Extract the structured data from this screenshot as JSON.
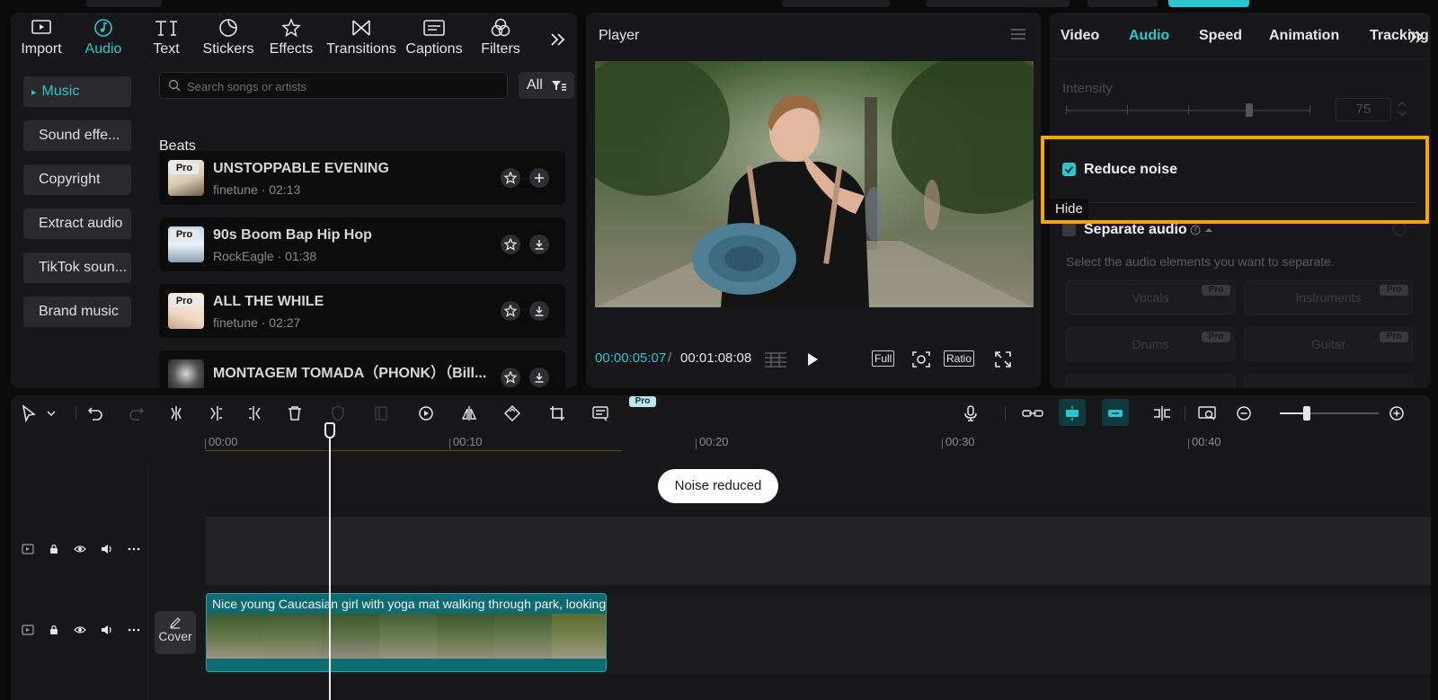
{
  "media_panel": {
    "tabs": [
      {
        "label": "Import",
        "icon": "import-icon"
      },
      {
        "label": "Audio",
        "icon": "audio-icon"
      },
      {
        "label": "Text",
        "icon": "text-icon"
      },
      {
        "label": "Stickers",
        "icon": "stickers-icon"
      },
      {
        "label": "Effects",
        "icon": "effects-icon"
      },
      {
        "label": "Transitions",
        "icon": "transitions-icon"
      },
      {
        "label": "Captions",
        "icon": "captions-icon"
      },
      {
        "label": "Filters",
        "icon": "filters-icon"
      }
    ],
    "active_tab": "Audio",
    "categories": [
      "Music",
      "Sound effe...",
      "Copyright",
      "Extract audio",
      "TikTok soun...",
      "Brand music"
    ],
    "active_category": "Music",
    "search_placeholder": "Search songs or artists",
    "filter_label": "All",
    "section_title": "Beats",
    "pro_badge": "Pro",
    "tracks": [
      {
        "name": "UNSTOPPABLE EVENING",
        "meta": "finetune · 02:13",
        "action": "add-icon"
      },
      {
        "name": "90s Boom Bap Hip Hop",
        "meta": "RockEagle · 01:38",
        "action": "download-icon"
      },
      {
        "name": "ALL THE WHILE",
        "meta": "finetune · 02:27",
        "action": "download-icon"
      },
      {
        "name": "MONTAGEM TOMADA（PHONK）（Bill...",
        "meta": "",
        "action": "download-icon"
      }
    ]
  },
  "player": {
    "title": "Player",
    "current_time": "00:00:05:07",
    "separator": "/",
    "total_time": "00:01:08:08",
    "full_label": "Full",
    "ratio_label": "Ratio"
  },
  "inspector": {
    "tabs": [
      "Video",
      "Audio",
      "Speed",
      "Animation",
      "Tracking"
    ],
    "active_tab": "Audio",
    "intensity_label": "Intensity",
    "intensity_value": "75",
    "reduce_noise_label": "Reduce noise",
    "reduce_noise_checked": true,
    "tooltip": "Hide",
    "separate_audio_label": "Separate audio",
    "separate_audio_desc": "Select the audio elements you want to separate.",
    "separate_options": [
      "Vocals",
      "Instruments",
      "Drums",
      "Guitar"
    ],
    "pro_badge": "Pro",
    "highlight_color": "#f5a700"
  },
  "timeline": {
    "pro_badge": "Pro",
    "ruler": [
      "00:00",
      "00:10",
      "00:20",
      "00:30",
      "00:40"
    ],
    "toast": "Noise reduced",
    "cover_label": "Cover",
    "clip_title": "Nice young Caucasian girl with yoga mat walking through park, looking around",
    "accent": "#2ec5ce"
  }
}
